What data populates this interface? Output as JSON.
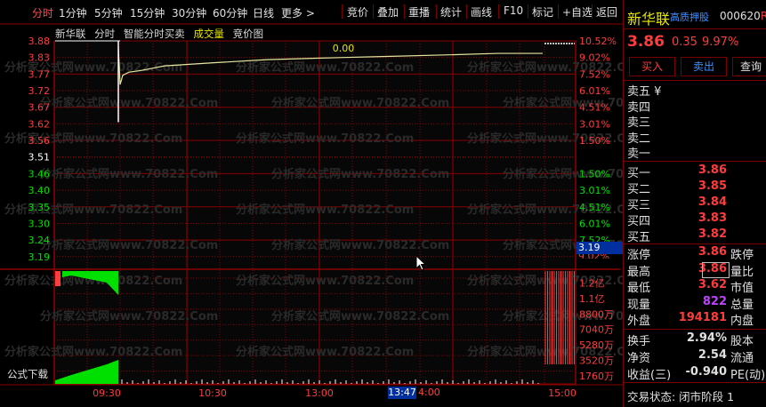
{
  "toolbar": {
    "periods": [
      "分时",
      "1分钟",
      "5分钟",
      "15分钟",
      "30分钟",
      "60分钟",
      "日线",
      "更多 >"
    ],
    "actions": [
      "竞价",
      "叠加",
      "重播",
      "统计",
      "画线",
      "F10",
      "标记",
      "+自选",
      "返回"
    ]
  },
  "chart_header": {
    "stock_name": "新华联",
    "items": [
      "分时",
      "智能分时买卖"
    ],
    "volume_label": "成交量",
    "auction_label": "竞价图",
    "center_value": "0.00"
  },
  "price_axis": {
    "prices": [
      "3.88",
      "3.83",
      "3.77",
      "3.72",
      "3.67",
      "3.62",
      "3.56",
      "3.51",
      "3.46",
      "3.40",
      "3.35",
      "3.30",
      "3.24",
      "3.19"
    ],
    "percents": [
      "10.52%",
      "9.02%",
      "7.52%",
      "6.01%",
      "4.51%",
      "3.01%",
      "1.50%",
      "",
      "1.50%",
      "3.01%",
      "4.51%",
      "6.01%",
      "7.52%",
      ""
    ],
    "current_price_tag": "3.19",
    "cut_percent": "9.02%"
  },
  "volume_axis": {
    "labels": [
      "1.2亿",
      "1.1亿",
      "8800万",
      "7040万",
      "5280万",
      "3520万",
      "1760万"
    ]
  },
  "time_axis": {
    "labels": [
      "09:30",
      "10:30",
      "13:00",
      "15:00"
    ],
    "cursor_time": "13:47",
    "cursor_after": "4:00"
  },
  "formula_download": "公式下载",
  "watermark": "分析家公式网www.70822.Com",
  "chart_data": {
    "type": "line",
    "title": "",
    "xlabel": "",
    "ylabel": "",
    "ylim": [
      3.19,
      3.88
    ],
    "x": [
      "09:30",
      "09:31",
      "09:35",
      "09:45",
      "10:00",
      "10:30",
      "11:00",
      "11:30",
      "13:00",
      "13:30",
      "14:00",
      "14:30",
      "15:00"
    ],
    "series": [
      {
        "values": [
          3.86,
          3.74,
          3.77,
          3.78,
          3.785,
          3.8,
          3.81,
          3.82,
          3.825,
          3.83,
          3.835,
          3.84,
          3.84
        ]
      }
    ]
  },
  "quote": {
    "name": "新华联",
    "tag": "高质押股",
    "code": "000620",
    "code_suffix": "R",
    "price": "3.86",
    "change": "0.35",
    "change_pct": "9.97%",
    "buy_btn": "买入",
    "sell_btn": "卖出",
    "query_btn": "查询"
  },
  "ask_book": [
    {
      "label": "卖五 ¥",
      "price": "",
      "vol": ""
    },
    {
      "label": "卖四",
      "price": "",
      "vol": ""
    },
    {
      "label": "卖三",
      "price": "",
      "vol": ""
    },
    {
      "label": "卖二",
      "price": "",
      "vol": ""
    },
    {
      "label": "卖一",
      "price": "",
      "vol": ""
    }
  ],
  "bid_book": [
    {
      "label": "买一",
      "price": "3.86"
    },
    {
      "label": "买二",
      "price": "3.85"
    },
    {
      "label": "买三",
      "price": "3.84"
    },
    {
      "label": "买四",
      "price": "3.83"
    },
    {
      "label": "买五",
      "price": "3.82"
    }
  ],
  "stats": [
    {
      "label": "涨停",
      "value": "3.86",
      "right": "跌停"
    },
    {
      "label": "最高",
      "value": "3.86",
      "right": "量比"
    },
    {
      "label": "最低",
      "value": "3.62",
      "right": "市值"
    },
    {
      "label": "现量",
      "value": "822",
      "right": "总量"
    },
    {
      "label": "外盘",
      "value": "194181",
      "right": "内盘"
    }
  ],
  "stats2": [
    {
      "label": "换手",
      "value": "2.94%",
      "right": "股本"
    },
    {
      "label": "净资",
      "value": "2.54",
      "right": "流通"
    },
    {
      "label": "收益(三)",
      "value": "-0.940",
      "right": "PE(动)"
    }
  ],
  "trade_status": "交易状态: 闭市阶段 1",
  "colors": {
    "up": "#ff3c3c",
    "down": "#00e000",
    "grid": "#8a0000",
    "price_line": "#ffffff",
    "avg_line": "#e6e600",
    "vol_yellow": "#e6e600",
    "purple": "#c040ff"
  }
}
